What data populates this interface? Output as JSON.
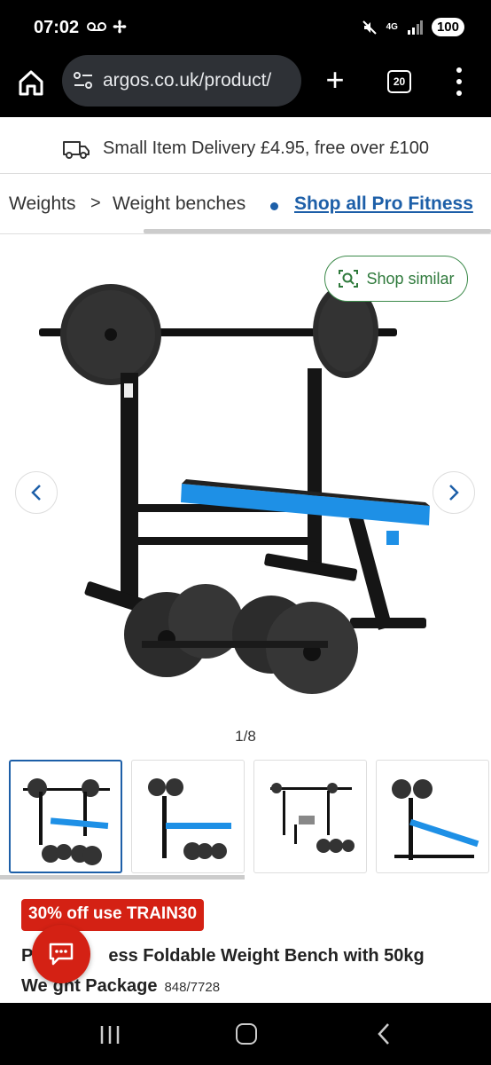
{
  "status_bar": {
    "time": "07:02",
    "network": "4G",
    "battery": "100"
  },
  "browser": {
    "url": "argos.co.uk/product/",
    "tab_count": "20"
  },
  "delivery_banner": {
    "text": "Small Item Delivery £4.95, free over £100"
  },
  "breadcrumb": {
    "items": [
      "Weights",
      "Weight benches"
    ],
    "link": "Shop all Pro Fitness"
  },
  "shop_similar": {
    "label": "Shop similar"
  },
  "gallery": {
    "indicator": "1/8",
    "thumbnail_count": 4
  },
  "product": {
    "promo": "30% off use TRAIN30",
    "title_visible_start": "P",
    "title_visible_rest": "ess Foldable Weight Bench with 50kg",
    "title_line2_start": "We",
    "title_line2_rest": "ght Package",
    "sku": "848/7728"
  },
  "colors": {
    "brand_blue": "#1d5fa8",
    "promo_red": "#d42114",
    "shop_similar_green": "#2f7a3c",
    "bench_blue": "#1e90e6"
  }
}
